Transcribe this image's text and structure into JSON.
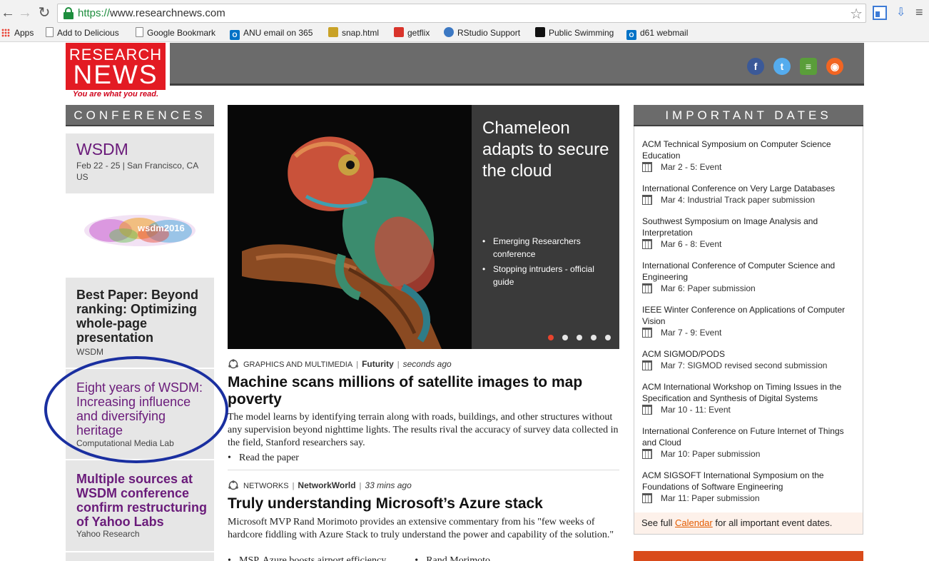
{
  "browser": {
    "url_scheme": "https://",
    "url_host": "www.researchnews.com",
    "bookmarks": [
      {
        "label": "Apps",
        "icon": "apps-grid-icon"
      },
      {
        "label": "Add to Delicious",
        "icon": "document-icon"
      },
      {
        "label": "Google Bookmark",
        "icon": "document-icon"
      },
      {
        "label": "ANU email on 365",
        "icon": "office365-icon"
      },
      {
        "label": "snap.html",
        "icon": "pickaxe-icon"
      },
      {
        "label": "getflix",
        "icon": "popcorn-icon"
      },
      {
        "label": "RStudio Support",
        "icon": "rstudio-icon"
      },
      {
        "label": "Public Swimming",
        "icon": "swimming-icon"
      },
      {
        "label": "d61 webmail",
        "icon": "office365-icon"
      }
    ]
  },
  "site": {
    "logo_line1": "RESEARCH",
    "logo_line2": "NEWS",
    "tagline": "You are what you read.",
    "social": [
      {
        "name": "facebook",
        "glyph": "f",
        "color": "#3b5998"
      },
      {
        "name": "twitter",
        "glyph": "t",
        "color": "#55acee"
      },
      {
        "name": "notes",
        "glyph": "≡",
        "color": "#5a9e3a"
      },
      {
        "name": "rss",
        "glyph": "◉",
        "color": "#f26522"
      }
    ]
  },
  "conferences": {
    "heading": "CONFERENCES",
    "current": {
      "name": "WSDM",
      "details": "Feb 22 - 25  |  San Francisco, CA US",
      "logo_text": "wsdm2016"
    },
    "stories": [
      {
        "title": "Best Paper: Beyond ranking: Optimizing whole-page presentation",
        "source": "WSDM"
      },
      {
        "title": "Eight years of WSDM: Increasing influence and diversifying heritage",
        "source": "Computational Media Lab"
      },
      {
        "title": "Multiple sources at WSDM conference confirm restructuring of Yahoo Labs",
        "source": "Yahoo Research"
      }
    ]
  },
  "carousel": {
    "title": "Chameleon adapts to secure the cloud",
    "links": [
      "Emerging Researchers conference",
      "Stopping intruders - official guide"
    ],
    "active_slide": 1,
    "slide_count": 5,
    "colors": {
      "active_dot": "#e8442d",
      "inactive_dot": "#e6e6e6"
    }
  },
  "articles": [
    {
      "topic": "GRAPHICS AND MULTIMEDIA",
      "source": "Futurity",
      "time": "seconds ago",
      "title": "Machine scans millions of satellite images to map poverty",
      "body": "The model learns by identifying terrain along with roads, buildings, and other structures without any supervision beyond nighttime lights. The results rival the accuracy of survey data collected in the field, Stanford researchers say.",
      "bullets": [
        "Read the paper"
      ]
    },
    {
      "topic": "NETWORKS",
      "source": "NetworkWorld",
      "time": "33 mins ago",
      "title": "Truly understanding Microsoft’s Azure stack",
      "body": "Microsoft MVP Rand Morimoto provides an extensive commentary from his \"few weeks of hardcore fiddling with Azure Stack to truly understand the power and capability of the solution.\"",
      "bullets": [
        "MSP, Azure boosts airport efficiency",
        "Rand Morimoto"
      ]
    }
  ],
  "important_dates": {
    "heading": "IMPORTANT DATES",
    "items": [
      {
        "title": "ACM Technical Symposium on Computer Science Education",
        "when": "Mar 2 - 5: Event"
      },
      {
        "title": "International Conference on Very Large Databases",
        "when": "Mar 4: Industrial Track paper submission"
      },
      {
        "title": "Southwest Symposium on Image Analysis and Interpretation",
        "when": "Mar 6 - 8: Event"
      },
      {
        "title": "International Conference of Computer Science and Engineering",
        "when": "Mar 6: Paper submission"
      },
      {
        "title": "IEEE Winter Conference on Applications of Computer Vision",
        "when": "Mar 7 - 9: Event"
      },
      {
        "title": "ACM SIGMOD/PODS",
        "when": "Mar 7: SIGMOD revised second submission"
      },
      {
        "title": "ACM International Workshop on Timing Issues in the Specification and Synthesis of Digital Systems",
        "when": "Mar 10 - 11: Event"
      },
      {
        "title": "International Conference on Future Internet of Things and Cloud",
        "when": "Mar 10: Paper submission"
      },
      {
        "title": "ACM SIGSOFT International Symposium on the Foundations of Software Engineering",
        "when": "Mar 11: Paper submission"
      }
    ],
    "note_prefix": "See full ",
    "note_link": "Calendar",
    "note_suffix": " for all important event dates."
  }
}
